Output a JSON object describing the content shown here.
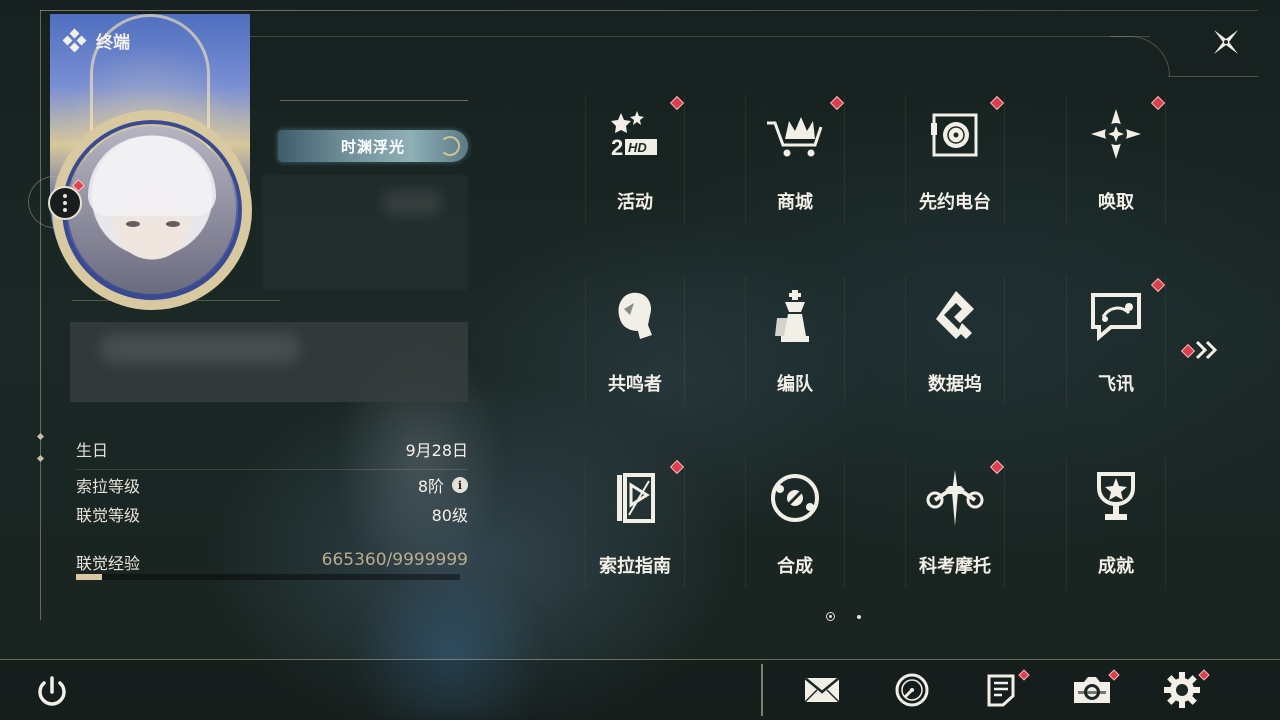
{
  "terminal": {
    "title": "终端"
  },
  "profile": {
    "title_plaque": "时渊浮光",
    "stats": [
      {
        "label": "生日",
        "value": "9月28日"
      },
      {
        "label": "索拉等级",
        "value": "8阶"
      },
      {
        "label": "联觉等级",
        "value": "80级"
      }
    ],
    "experience": {
      "label": "联觉经验",
      "value": "665360/9999999",
      "progress": 0.0665
    }
  },
  "menu": {
    "items": [
      {
        "label": "活动",
        "icon": "event-2hd-icon",
        "badge": true
      },
      {
        "label": "商城",
        "icon": "shop-crown-cart-icon",
        "badge": true
      },
      {
        "label": "先约电台",
        "icon": "radio-turntable-icon",
        "badge": true
      },
      {
        "label": "唤取",
        "icon": "compass-star-icon",
        "badge": true
      },
      {
        "label": "共鸣者",
        "icon": "resonator-profile-icon",
        "badge": false
      },
      {
        "label": "编队",
        "icon": "team-chess-icon",
        "badge": false
      },
      {
        "label": "数据坞",
        "icon": "data-dock-icon",
        "badge": false
      },
      {
        "label": "飞讯",
        "icon": "message-chat-icon",
        "badge": true
      },
      {
        "label": "索拉指南",
        "icon": "guide-book-icon",
        "badge": true
      },
      {
        "label": "合成",
        "icon": "synthesis-orbit-icon",
        "badge": false
      },
      {
        "label": "科考摩托",
        "icon": "motorcycle-icon",
        "badge": true
      },
      {
        "label": "成就",
        "icon": "trophy-icon",
        "badge": false
      }
    ],
    "pagination": {
      "current": 1,
      "total": 2
    }
  },
  "bottom_bar": {
    "buttons": [
      {
        "name": "mail",
        "icon": "mail-icon",
        "badge": false
      },
      {
        "name": "clock",
        "icon": "clock-icon",
        "badge": false
      },
      {
        "name": "notes",
        "icon": "notes-icon",
        "badge": true
      },
      {
        "name": "camera",
        "icon": "camera-icon",
        "badge": true
      },
      {
        "name": "settings",
        "icon": "gear-icon",
        "badge": true
      }
    ]
  },
  "colors": {
    "accent": "#d8c9a4",
    "badge": "#d8404c",
    "text": "#f2efe6"
  }
}
